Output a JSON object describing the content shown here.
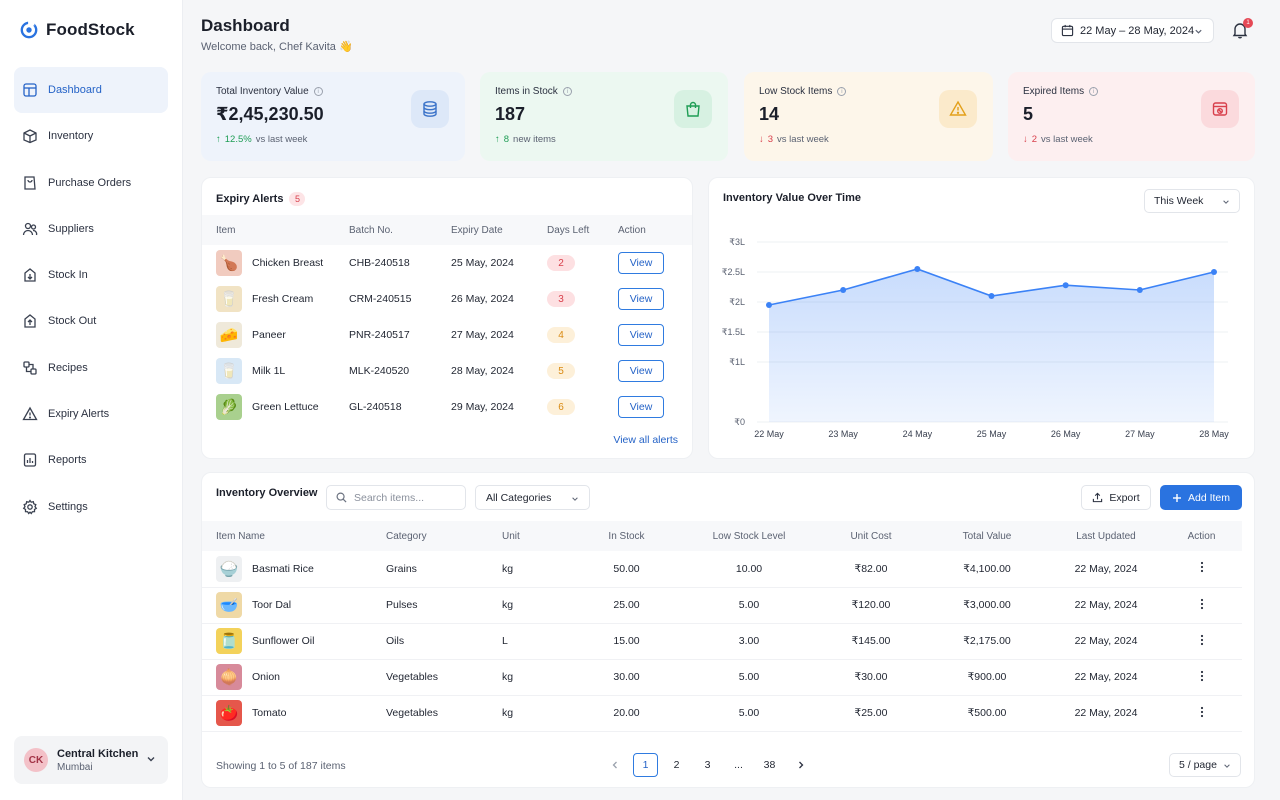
{
  "app": {
    "name": "FoodStock"
  },
  "sidebar": {
    "items": [
      {
        "label": "Dashboard",
        "icon": "dashboard-icon"
      },
      {
        "label": "Inventory",
        "icon": "box-icon"
      },
      {
        "label": "Purchase Orders",
        "icon": "cart-icon"
      },
      {
        "label": "Suppliers",
        "icon": "users-icon"
      },
      {
        "label": "Stock In",
        "icon": "stock-in-icon"
      },
      {
        "label": "Stock Out",
        "icon": "stock-out-icon"
      },
      {
        "label": "Recipes",
        "icon": "recipes-icon"
      },
      {
        "label": "Expiry Alerts",
        "icon": "alert-icon"
      },
      {
        "label": "Reports",
        "icon": "reports-icon"
      },
      {
        "label": "Settings",
        "icon": "gear-icon"
      }
    ],
    "org": {
      "initials": "CK",
      "name": "Central Kitchen",
      "city": "Mumbai"
    }
  },
  "header": {
    "title": "Dashboard",
    "welcome": "Welcome back, Chef Kavita 👋",
    "date_range": "22 May – 28 May, 2024",
    "notification_count": "1"
  },
  "stats": [
    {
      "label": "Total Inventory Value",
      "value": "₹2,45,230.50",
      "delta": "12.5%",
      "delta_dir": "up",
      "sub": "vs last week",
      "bg": "#eef3fb",
      "icon_bg": "#dde8f8",
      "icon_color": "#3b73c9"
    },
    {
      "label": "Items in Stock",
      "value": "187",
      "delta": "8",
      "delta_dir": "up",
      "sub": "new items",
      "bg": "#ecf8f1",
      "icon_bg": "#d7f1e2",
      "icon_color": "#1f9d55"
    },
    {
      "label": "Low Stock Items",
      "value": "14",
      "delta": "3",
      "delta_dir": "down",
      "sub": "vs last week",
      "bg": "#fdf6ea",
      "icon_bg": "#fbeacb",
      "icon_color": "#e3a01a"
    },
    {
      "label": "Expired Items",
      "value": "5",
      "delta": "2",
      "delta_dir": "down",
      "sub": "vs last week",
      "bg": "#fdeff0",
      "icon_bg": "#fbdadd",
      "icon_color": "#d8404c"
    }
  ],
  "expiry": {
    "title": "Expiry Alerts",
    "count": "5",
    "columns": [
      "Item",
      "Batch No.",
      "Expiry Date",
      "Days Left",
      "Action"
    ],
    "rows": [
      {
        "item": "Chicken Breast",
        "batch": "CHB-240518",
        "date": "25 May, 2024",
        "days": "2",
        "pill_bg": "#fde0e2",
        "pill_fg": "#d8404c",
        "thumb": "#f1cbbf"
      },
      {
        "item": "Fresh Cream",
        "batch": "CRM-240515",
        "date": "26 May, 2024",
        "days": "3",
        "pill_bg": "#fde0e2",
        "pill_fg": "#d8404c",
        "thumb": "#f1e3c4"
      },
      {
        "item": "Paneer",
        "batch": "PNR-240517",
        "date": "27 May, 2024",
        "days": "4",
        "pill_bg": "#fdf0d9",
        "pill_fg": "#d98a12",
        "thumb": "#efe9da"
      },
      {
        "item": "Milk 1L",
        "batch": "MLK-240520",
        "date": "28 May, 2024",
        "days": "5",
        "pill_bg": "#fdf0d9",
        "pill_fg": "#d98a12",
        "thumb": "#d8e8f6"
      },
      {
        "item": "Green Lettuce",
        "batch": "GL-240518",
        "date": "29 May, 2024",
        "days": "6",
        "pill_bg": "#fdf0d9",
        "pill_fg": "#d98a12",
        "thumb": "#a9d08e"
      }
    ],
    "view_label": "View",
    "view_all": "View all alerts"
  },
  "chart_panel": {
    "title": "Inventory Value Over Time",
    "period": "This Week"
  },
  "chart_data": {
    "type": "area",
    "title": "Inventory Value Over Time",
    "x": [
      "22 May",
      "23 May",
      "24 May",
      "25 May",
      "26 May",
      "27 May",
      "28 May"
    ],
    "series": [
      {
        "values": [
          1.95,
          2.2,
          2.55,
          2.1,
          2.28,
          2.2,
          2.5
        ]
      }
    ],
    "y_ticks": [
      "₹0",
      "₹1L",
      "₹1.5L",
      "₹2L",
      "₹2.5L",
      "₹3L"
    ],
    "y_tick_values": [
      0,
      1,
      1.5,
      2,
      2.5,
      3
    ],
    "ylim": [
      0,
      3
    ],
    "grid": true,
    "color": "#3b82f6"
  },
  "inventory": {
    "title": "Inventory Overview",
    "search_placeholder": "Search items...",
    "category": "All Categories",
    "export": "Export",
    "add": "Add Item",
    "columns": [
      "Item Name",
      "Category",
      "Unit",
      "In Stock",
      "Low Stock Level",
      "Unit Cost",
      "Total Value",
      "Last Updated",
      "Action"
    ],
    "rows": [
      {
        "name": "Basmati Rice",
        "category": "Grains",
        "unit": "kg",
        "stock": "50.00",
        "low": "10.00",
        "cost": "₹82.00",
        "total": "₹4,100.00",
        "updated": "22 May, 2024",
        "thumb": "#eef0f2"
      },
      {
        "name": "Toor Dal",
        "category": "Pulses",
        "unit": "kg",
        "stock": "25.00",
        "low": "5.00",
        "cost": "₹120.00",
        "total": "₹3,000.00",
        "updated": "22 May, 2024",
        "thumb": "#efd9a6"
      },
      {
        "name": "Sunflower Oil",
        "category": "Oils",
        "unit": "L",
        "stock": "15.00",
        "low": "3.00",
        "cost": "₹145.00",
        "total": "₹2,175.00",
        "updated": "22 May, 2024",
        "thumb": "#f3d25b"
      },
      {
        "name": "Onion",
        "category": "Vegetables",
        "unit": "kg",
        "stock": "30.00",
        "low": "5.00",
        "cost": "₹30.00",
        "total": "₹900.00",
        "updated": "22 May, 2024",
        "thumb": "#d78a9a"
      },
      {
        "name": "Tomato",
        "category": "Vegetables",
        "unit": "kg",
        "stock": "20.00",
        "low": "5.00",
        "cost": "₹25.00",
        "total": "₹500.00",
        "updated": "22 May, 2024",
        "thumb": "#e5574b"
      }
    ],
    "showing": "Showing 1 to 5 of 187 items",
    "pages": [
      "1",
      "2",
      "3",
      "...",
      "38"
    ],
    "per_page": "5 / page"
  }
}
